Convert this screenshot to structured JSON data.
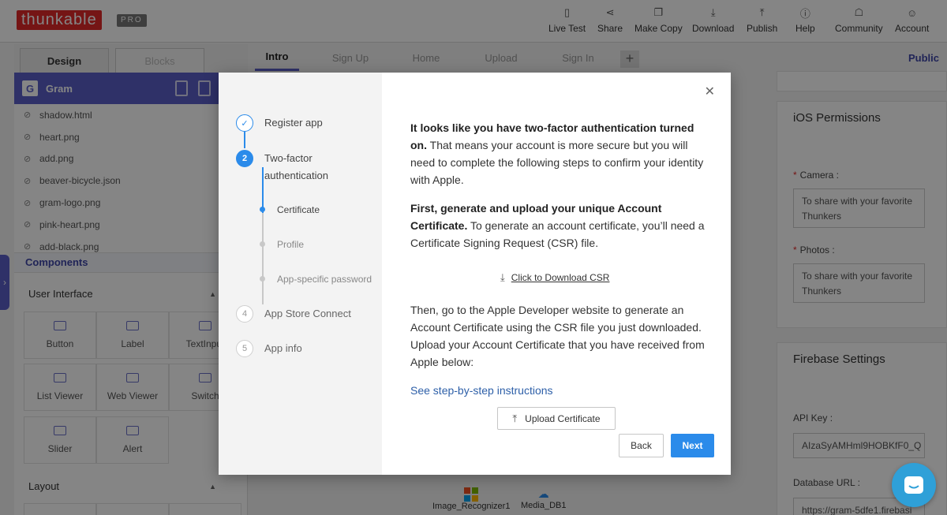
{
  "brand": {
    "logo_text": "thunkable",
    "badge": "PRO"
  },
  "topnav": [
    {
      "label": "Live Test",
      "icon": "phone-icon"
    },
    {
      "label": "Share",
      "icon": "share-icon"
    },
    {
      "label": "Make Copy",
      "icon": "copy-icon"
    },
    {
      "label": "Download",
      "icon": "download-icon"
    },
    {
      "label": "Publish",
      "icon": "publish-icon"
    },
    {
      "label": "Help",
      "icon": "help-icon"
    },
    {
      "label": "Community",
      "icon": "community-icon"
    },
    {
      "label": "Account",
      "icon": "account-icon"
    }
  ],
  "left_panel": {
    "tabs": {
      "design": "Design",
      "blocks": "Blocks"
    },
    "project": {
      "letter": "G",
      "name": "Gram"
    },
    "files": [
      "shadow.html",
      "heart.png",
      "add.png",
      "beaver-bicycle.json",
      "gram-logo.png",
      "pink-heart.png",
      "add-black.png"
    ],
    "components_title": "Components",
    "user_interface_title": "User Interface",
    "ui_components": [
      "Button",
      "Label",
      "TextInput",
      "List Viewer",
      "Web Viewer",
      "Switch",
      "Slider",
      "Alert"
    ],
    "layout_title": "Layout"
  },
  "screen_tabs": [
    "Intro",
    "Sign Up",
    "Home",
    "Upload",
    "Sign In"
  ],
  "screen_tab_add": "+",
  "visibility": "Public",
  "bottom_components": [
    "Image_Recognizer1",
    "Media_DB1"
  ],
  "right_panel": {
    "ios_title": "iOS Permissions",
    "camera_label": "Camera :",
    "camera_value": "To share with your favorite Thunkers",
    "photos_label": "Photos :",
    "photos_value": "To share with your favorite Thunkers",
    "required_mark": "*",
    "firebase_title": "Firebase Settings",
    "api_key_label": "API Key :",
    "api_key_value": "AIzaSyAMHml9HOBKfF0_Q",
    "db_url_label": "Database URL :",
    "db_url_value": "https://gram-5dfe1.firebasi"
  },
  "modal": {
    "steps": [
      {
        "num": "✓",
        "label": "Register app",
        "state": "done"
      },
      {
        "num": "2",
        "label": "Two-factor authentication",
        "state": "active"
      },
      {
        "num": "4",
        "label": "App Store Connect",
        "state": "pending"
      },
      {
        "num": "5",
        "label": "App info",
        "state": "pending"
      }
    ],
    "substeps": [
      "Certificate",
      "Profile",
      "App-specific password"
    ],
    "para1_bold": "It looks like you have two-factor authentication turned on.",
    "para1_rest": " That means your account is more secure but you will need to complete the following steps to confirm your identity with Apple.",
    "para2_bold": "First, generate and upload your unique Account Certificate.",
    "para2_rest": " To generate an account certificate, you’ll need a Certificate Signing Request (CSR) file.",
    "download_link": "Click to Download CSR",
    "para3": "Then, go to the Apple Developer website to generate an Account Certificate using the CSR file you just downloaded. Upload your Account Certificate that you have received from Apple below:",
    "instructions_link": "See step-by-step instructions",
    "upload_button": "Upload Certificate",
    "back_button": "Back",
    "next_button": "Next",
    "close": "✕"
  }
}
